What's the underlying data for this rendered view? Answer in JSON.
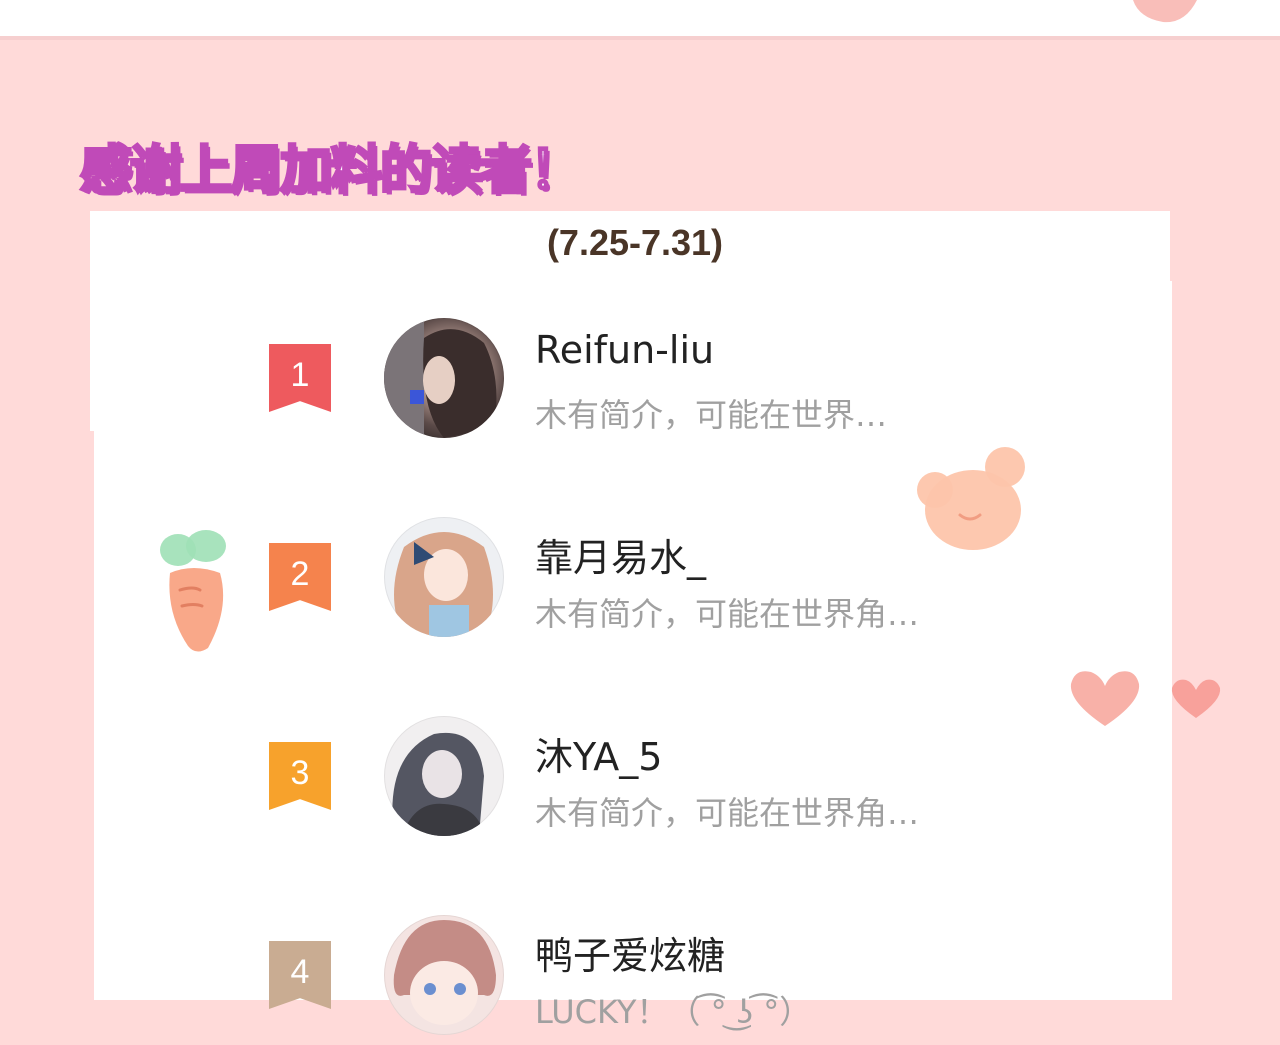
{
  "heading": "感谢上周加料的读者！",
  "date_range": "(7.25-7.31)",
  "colors": {
    "background": "#ffdad9",
    "heading_outline": "#c04ab8",
    "rank_1": "#ee5a5e",
    "rank_2": "#f5834d",
    "rank_3": "#f7a22c",
    "rank_4": "#c9ac92"
  },
  "readers": [
    {
      "rank": "1",
      "name": "Reifun-liu",
      "bio": "木有简介，可能在世界…"
    },
    {
      "rank": "2",
      "name": "靠月易水_",
      "bio": "木有简介，可能在世界角…"
    },
    {
      "rank": "3",
      "name": "沐YA_5",
      "bio": "木有简介，可能在世界角…"
    },
    {
      "rank": "4",
      "name": "鸭子爱炫糖",
      "bio": "LUCKY！（ ͡° ͜ʖ ͡°）"
    }
  ],
  "decorations": [
    "carrot-icon",
    "bear-head-icon",
    "heart-icon"
  ]
}
